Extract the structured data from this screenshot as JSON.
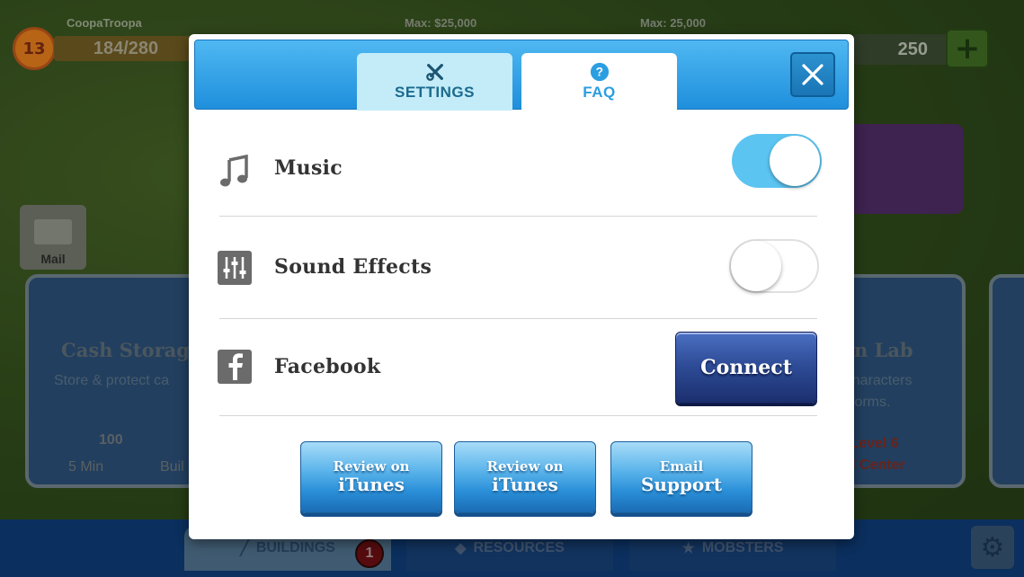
{
  "hud": {
    "player_name": "CoopaTroopa",
    "level": "13",
    "xp": "184/280",
    "max_cash": "Max: $25,000",
    "max_resource": "Max: 25,000",
    "gems": "250",
    "plus": "+",
    "mail_label": "Mail"
  },
  "background_cards": {
    "left_title": "Cash Storag",
    "left_sub": "Store & protect ca",
    "left_cost": "100",
    "left_time": "5 Min",
    "left_build": "Buil",
    "right_title": "ion Lab",
    "right_sub1": "r characters",
    "right_sub2": "w forms.",
    "right_req1": "s Level 6",
    "right_req2": "nd Center"
  },
  "bottom_nav": {
    "tabs": [
      {
        "label": "BUILDINGS"
      },
      {
        "label": "RESOURCES"
      },
      {
        "label": "MOBSTERS"
      }
    ],
    "badge": "1"
  },
  "modal": {
    "tabs": [
      {
        "label": "SETTINGS",
        "icon": "wrench-screwdriver-icon"
      },
      {
        "label": "FAQ",
        "icon": "question-icon"
      }
    ],
    "active_tab": "FAQ",
    "rows": [
      {
        "label": "Music",
        "icon": "music-note-icon",
        "control": "toggle",
        "on": true
      },
      {
        "label": "Sound Effects",
        "icon": "sliders-icon",
        "control": "toggle",
        "on": false
      },
      {
        "label": "Facebook",
        "icon": "facebook-icon",
        "control": "button",
        "button_label": "Connect"
      }
    ],
    "buttons": [
      {
        "line1": "Review on",
        "line2": "iTunes"
      },
      {
        "line1": "Review on",
        "line2": "iTunes"
      },
      {
        "line1": "Email",
        "line2": "Support"
      }
    ]
  },
  "colors": {
    "header_blue": "#1f8fdc",
    "toggle_on": "#5cc4f1",
    "connect_navy": "#2f4d98",
    "faq_text": "#2b9ee2"
  }
}
